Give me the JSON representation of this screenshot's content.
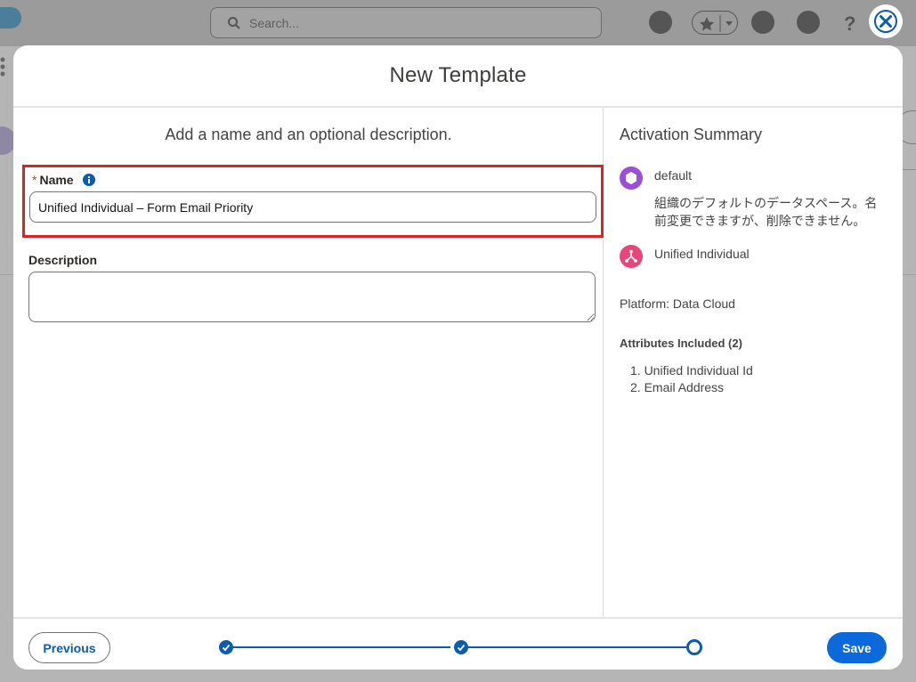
{
  "background": {
    "search_placeholder": "Search..."
  },
  "modal": {
    "title": "New Template",
    "left": {
      "subtitle": "Add a name and an optional description.",
      "name_required_marker": "*",
      "name_label": "Name",
      "name_value": "Unified Individual – Form Email Priority",
      "description_label": "Description",
      "description_value": ""
    },
    "summary": {
      "title": "Activation Summary",
      "dataspace_name": "default",
      "dataspace_description": "組織のデフォルトのデータスペース。名前変更できますが、削除できません。",
      "dataspace_icon": "hexagon-icon",
      "dataspace_color": "#9a4fd6",
      "object_name": "Unified Individual",
      "object_icon": "merge-icon",
      "object_color": "#e6477a",
      "platform": "Platform: Data Cloud",
      "attributes_title": "Attributes Included (2)",
      "attributes": [
        "1. Unified Individual Id",
        "2. Email Address"
      ]
    },
    "footer": {
      "previous_label": "Previous",
      "save_label": "Save",
      "steps": [
        "complete",
        "complete",
        "current"
      ],
      "accent_color": "#0b5cab"
    }
  }
}
